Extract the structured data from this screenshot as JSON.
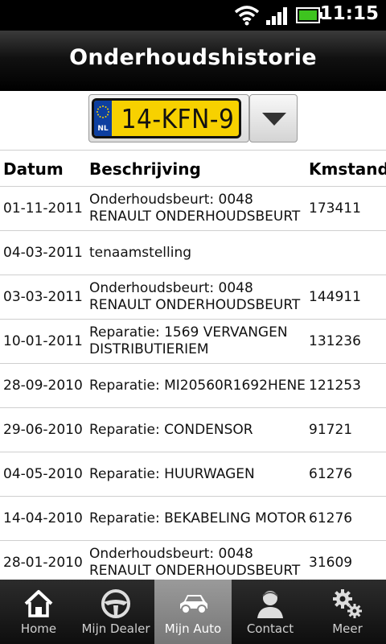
{
  "status_bar": {
    "time": "11:15",
    "wifi_icon": "wifi-icon",
    "signal_icon": "signal-icon",
    "battery_icon": "battery-icon"
  },
  "header": {
    "title": "Onderhoudshistorie"
  },
  "vehicle_selector": {
    "plate_number": "14-KFN-9",
    "country_code": "NL",
    "dropdown_icon": "chevron-down-icon"
  },
  "table": {
    "columns": [
      "Datum",
      "Beschrijving",
      "Kmstand"
    ],
    "rows": [
      {
        "date": "01-11-2011",
        "description": "Onderhoudsbeurt: 0048 RENAULT ONDERHOUDSBEURT",
        "km": "173411"
      },
      {
        "date": "04-03-2011",
        "description": "tenaamstelling",
        "km": ""
      },
      {
        "date": "03-03-2011",
        "description": "Onderhoudsbeurt: 0048 RENAULT ONDERHOUDSBEURT",
        "km": "144911"
      },
      {
        "date": "10-01-2011",
        "description": "Reparatie: 1569 VERVANGEN DISTRIBUTIERIEM",
        "km": "131236"
      },
      {
        "date": "28-09-2010",
        "description": "Reparatie: MI20560R1692HENE",
        "km": "121253"
      },
      {
        "date": "29-06-2010",
        "description": "Reparatie: CONDENSOR",
        "km": "91721"
      },
      {
        "date": "04-05-2010",
        "description": "Reparatie: HUURWAGEN",
        "km": "61276"
      },
      {
        "date": "14-04-2010",
        "description": "Reparatie: BEKABELING MOTOR",
        "km": "61276"
      },
      {
        "date": "28-01-2010",
        "description": "Onderhoudsbeurt: 0048 RENAULT ONDERHOUDSBEURT",
        "km": "31609"
      }
    ]
  },
  "bottom_nav": {
    "items": [
      {
        "label": "Home",
        "icon": "home-icon",
        "active": false
      },
      {
        "label": "Mijn Dealer",
        "icon": "steering-wheel-icon",
        "active": false
      },
      {
        "label": "Mijn Auto",
        "icon": "car-icon",
        "active": true
      },
      {
        "label": "Contact",
        "icon": "person-icon",
        "active": false
      },
      {
        "label": "Meer",
        "icon": "gears-icon",
        "active": false
      }
    ]
  }
}
